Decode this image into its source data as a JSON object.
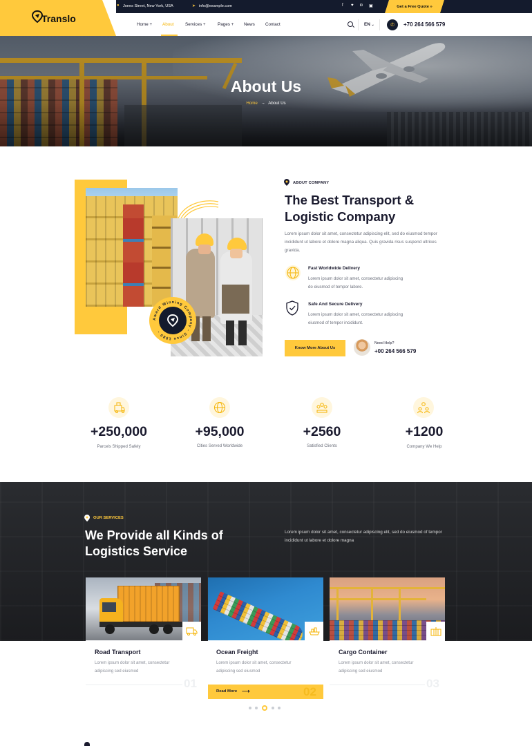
{
  "brand": {
    "name": "Translo",
    "accent": "#ffc93c",
    "dark": "#141b2d"
  },
  "topbar": {
    "address": "Jones Street, New York, USA",
    "email": "info@example.com",
    "social_icons": [
      "facebook-icon",
      "twitter-icon",
      "instagram-icon",
      "linkedin-icon"
    ],
    "quote_label": "Get a Free Quote »"
  },
  "nav": {
    "items": [
      {
        "label": "Home +"
      },
      {
        "label": "About"
      },
      {
        "label": "Services +"
      },
      {
        "label": "Pages +"
      },
      {
        "label": "News"
      },
      {
        "label": "Contact"
      }
    ],
    "active_index": 1,
    "lang": "EN",
    "phone": "+70 264 566 579"
  },
  "hero": {
    "title": "About Us",
    "crumb_home": "Home",
    "crumb_arrow": "→",
    "crumb_current": "About Us"
  },
  "about": {
    "tag": "ABOUT COMPANY",
    "title_line1": "The Best Transport &",
    "title_line2": "Logistic Company",
    "description": "Lorem ipsum dolor sit amet, consectetur adipiscing elit, sed do eiusmod tempor incididunt ut labore et dolore magna aliqua. Quis gravida risus suspend ultrices gravida.",
    "award_ring_text": "Award Winning Company - Since 1980 -",
    "features": [
      {
        "icon": "globe-icon",
        "title": "Fast Worldwide Delivery",
        "line1": "Lorem ipsum dolor sit amet, consectetur adipiscing",
        "line2": "do eiusmod of tempor labore."
      },
      {
        "icon": "shield-icon",
        "title": "Safe And Secure Delivery",
        "line1": "Lorem ipsum dolor sit amet, consectetur adipiscing",
        "line2": "eiusmod of tempor incididunt."
      }
    ],
    "button_label": "Know More About Us",
    "help_label": "Need Help?",
    "help_phone": "+00 264 566 579"
  },
  "counters": [
    {
      "icon": "parcel-icon",
      "value": "+250,000",
      "label": "Parcels Shipped Safely"
    },
    {
      "icon": "globe-icon",
      "value": "+95,000",
      "label": "Cities Served Worldwide"
    },
    {
      "icon": "clients-icon",
      "value": "+2560",
      "label": "Satisfied Clients"
    },
    {
      "icon": "team-icon",
      "value": "+1200",
      "label": "Company We Help"
    }
  ],
  "services": {
    "tag": "OUR SERVICES",
    "title_line1": "We Provide all Kinds of",
    "title_line2": "Logistics Service",
    "description": "Lorem ipsum dolor sit amet, consectetur adipiscing elit, sed do eiusmod of tempor incididunt ut labore et dolore magna",
    "cards": [
      {
        "title": "Road Transport",
        "line1": "Lorem ipsum dolor sit amet, consectetur",
        "line2": "adipiscing sed eiusmod",
        "number": "01",
        "icon": "truck-icon"
      },
      {
        "title": "Ocean Freight",
        "line1": "Lorem ipsum dolor sit amet, consectetur",
        "line2": "adipiscing sed eiusmod",
        "number": "02",
        "icon": "ship-icon"
      },
      {
        "title": "Cargo Container",
        "line1": "Lorem ipsum dolor sit amet, consectetur",
        "line2": "adipiscing sed eiusmod",
        "number": "03",
        "icon": "container-icon"
      }
    ],
    "read_more": "Read More",
    "slider_active": 2
  }
}
